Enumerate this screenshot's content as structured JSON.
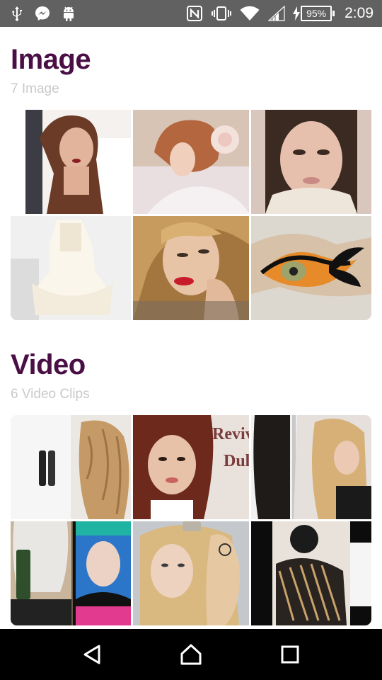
{
  "status_bar": {
    "left_icons": [
      "usb-icon",
      "messenger-icon",
      "android-icon"
    ],
    "right_icons": [
      "nfc-icon",
      "vibrate-icon",
      "wifi-icon",
      "signal-icon"
    ],
    "battery_percent": "95%",
    "time": "2:09"
  },
  "image_section": {
    "title": "Image",
    "subtitle": "7 Image",
    "tiles": [
      {
        "bg": "#d7b3a4",
        "accent": "#6b3b27"
      },
      {
        "bg": "#e8d8cc",
        "accent": "#b4663f"
      },
      {
        "bg": "#e6d4c9",
        "accent": "#3b2a22"
      },
      {
        "bg": "#f1f1f1",
        "accent": "#fbf7ef"
      },
      {
        "bg": "#c79a5d",
        "accent": "#9c1f28"
      },
      {
        "bg": "#d8d3c9",
        "accent": "#e68a2a"
      }
    ]
  },
  "video_section": {
    "title": "Video",
    "subtitle": "6 Video Clips",
    "tiles": [
      {
        "bg": "#e6e1da",
        "accent": "#c69a66"
      },
      {
        "bg": "#6d2a1c",
        "accent": "#e7cdbb",
        "overlay_text": [
          "Reviv",
          "Dull"
        ]
      },
      {
        "bg": "#f2f2f2",
        "accent": "#d6b077"
      },
      {
        "bg": "#2a2a2a",
        "accent": "#2c76c9"
      },
      {
        "bg": "#c9c3b8",
        "accent": "#d9b980"
      },
      {
        "bg": "#111111",
        "accent": "#8a7a6a"
      }
    ]
  },
  "nav_bar": {
    "buttons": [
      "back-icon",
      "home-icon",
      "recents-icon"
    ]
  }
}
